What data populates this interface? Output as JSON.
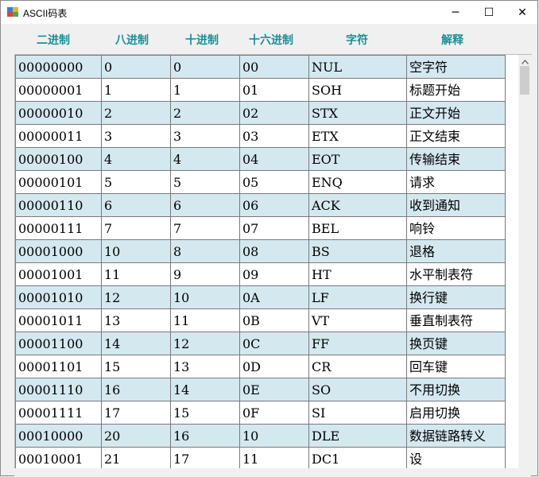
{
  "window": {
    "title": "ASCII码表",
    "controls": {
      "minimize": "─",
      "maximize": "☐",
      "close": "✕"
    }
  },
  "columns": [
    "二进制",
    "八进制",
    "十进制",
    "十六进制",
    "字符",
    "解释"
  ],
  "rows": [
    [
      "00000000",
      "0",
      "0",
      "00",
      "NUL",
      "空字符"
    ],
    [
      "00000001",
      "1",
      "1",
      "01",
      "SOH",
      "标题开始"
    ],
    [
      "00000010",
      "2",
      "2",
      "02",
      "STX",
      "正文开始"
    ],
    [
      "00000011",
      "3",
      "3",
      "03",
      "ETX",
      "正文结束"
    ],
    [
      "00000100",
      "4",
      "4",
      "04",
      "EOT",
      "传输结束"
    ],
    [
      "00000101",
      "5",
      "5",
      "05",
      "ENQ",
      "请求"
    ],
    [
      "00000110",
      "6",
      "6",
      "06",
      "ACK",
      "收到通知"
    ],
    [
      "00000111",
      "7",
      "7",
      "07",
      "BEL",
      "响铃"
    ],
    [
      "00001000",
      "10",
      "8",
      "08",
      "BS",
      "退格"
    ],
    [
      "00001001",
      "11",
      "9",
      "09",
      "HT",
      "水平制表符"
    ],
    [
      "00001010",
      "12",
      "10",
      "0A",
      "LF",
      "换行键"
    ],
    [
      "00001011",
      "13",
      "11",
      "0B",
      "VT",
      "垂直制表符"
    ],
    [
      "00001100",
      "14",
      "12",
      "0C",
      "FF",
      "换页键"
    ],
    [
      "00001101",
      "15",
      "13",
      "0D",
      "CR",
      "回车键"
    ],
    [
      "00001110",
      "16",
      "14",
      "0E",
      "SO",
      "不用切换"
    ],
    [
      "00001111",
      "17",
      "15",
      "0F",
      "SI",
      "启用切换"
    ],
    [
      "00010000",
      "20",
      "16",
      "10",
      "DLE",
      "数据链路转义"
    ],
    [
      "00010001",
      "21",
      "17",
      "11",
      "DC1",
      "设"
    ]
  ],
  "colors": {
    "header_text": "#1a8f96",
    "alt_row": "#d4e8f0",
    "row": "#ffffff"
  }
}
